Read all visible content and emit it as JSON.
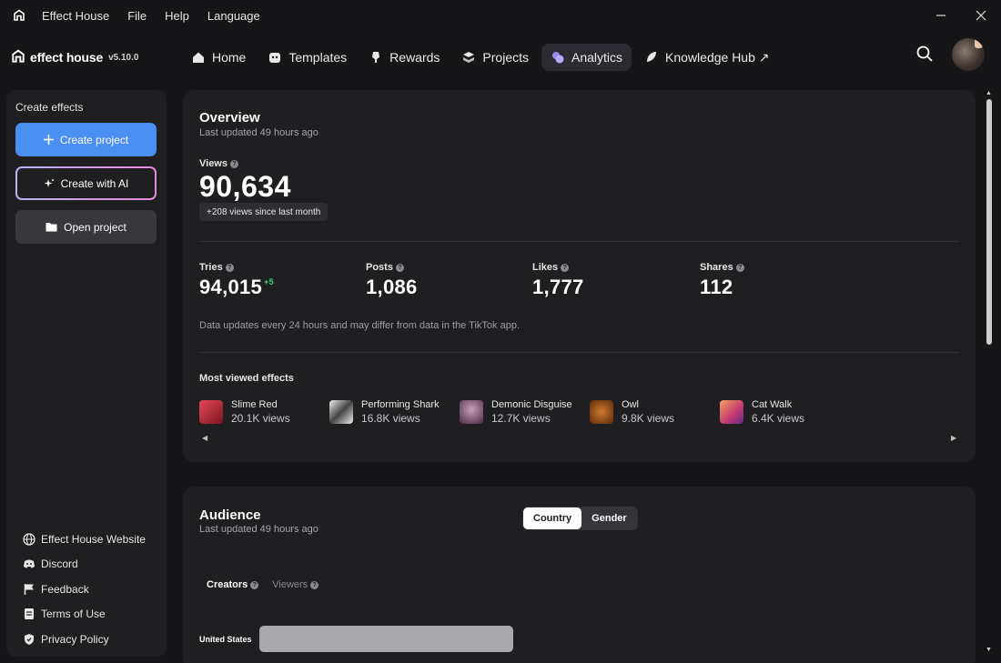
{
  "titlebar": {
    "icon": "effect-house-logo",
    "menu": [
      "Effect House",
      "File",
      "Help",
      "Language"
    ]
  },
  "brand": {
    "name": "effect house",
    "version": "v5.10.0"
  },
  "nav": {
    "tabs": [
      {
        "label": "Home",
        "icon": "home-icon"
      },
      {
        "label": "Templates",
        "icon": "templates-icon"
      },
      {
        "label": "Rewards",
        "icon": "rewards-icon"
      },
      {
        "label": "Projects",
        "icon": "projects-icon"
      },
      {
        "label": "Analytics",
        "icon": "analytics-icon",
        "active": true
      },
      {
        "label": "Knowledge Hub ↗",
        "icon": "knowledge-hub-icon"
      }
    ]
  },
  "sidebar": {
    "title": "Create effects",
    "create_project": "Create project",
    "create_ai": "Create with AI",
    "open_project": "Open project",
    "links": [
      {
        "label": "Effect House Website",
        "icon": "globe-icon"
      },
      {
        "label": "Discord",
        "icon": "discord-icon"
      },
      {
        "label": "Feedback",
        "icon": "flag-icon"
      },
      {
        "label": "Terms of Use",
        "icon": "document-icon"
      },
      {
        "label": "Privacy Policy",
        "icon": "shield-icon"
      }
    ]
  },
  "overview": {
    "title": "Overview",
    "updated": "Last updated 49 hours ago",
    "views_label": "Views",
    "views_value": "90,634",
    "views_delta": "+208 views since last month",
    "stats": [
      {
        "label": "Tries",
        "value": "94,015",
        "delta": "+5"
      },
      {
        "label": "Posts",
        "value": "1,086"
      },
      {
        "label": "Likes",
        "value": "1,777"
      },
      {
        "label": "Shares",
        "value": "112"
      }
    ],
    "note": "Data updates every 24 hours and may differ from data in the TikTok app.",
    "most_viewed_title": "Most viewed effects",
    "effects": [
      {
        "name": "Slime Red",
        "views": "20.1K views",
        "color": "#c0283a"
      },
      {
        "name": "Performing Shark",
        "views": "16.8K views",
        "color": "#d8d8d8"
      },
      {
        "name": "Demonic Disguise",
        "views": "12.7K views",
        "color": "#7a4a6a"
      },
      {
        "name": "Owl",
        "views": "9.8K views",
        "color": "#a8561e"
      },
      {
        "name": "Cat Walk",
        "views": "6.4K views",
        "color": "#d6607a"
      }
    ]
  },
  "audience": {
    "title": "Audience",
    "updated": "Last updated 49 hours ago",
    "segments": [
      "Country",
      "Gender"
    ],
    "active_segment": "Country",
    "subtabs": [
      "Creators",
      "Viewers"
    ],
    "active_subtab": "Creators",
    "countries": [
      {
        "name": "United States"
      }
    ]
  },
  "colors": {
    "accent": "#4b8ff3",
    "positive": "#3ed47a",
    "background": "#161618",
    "card": "#1f1f22"
  }
}
